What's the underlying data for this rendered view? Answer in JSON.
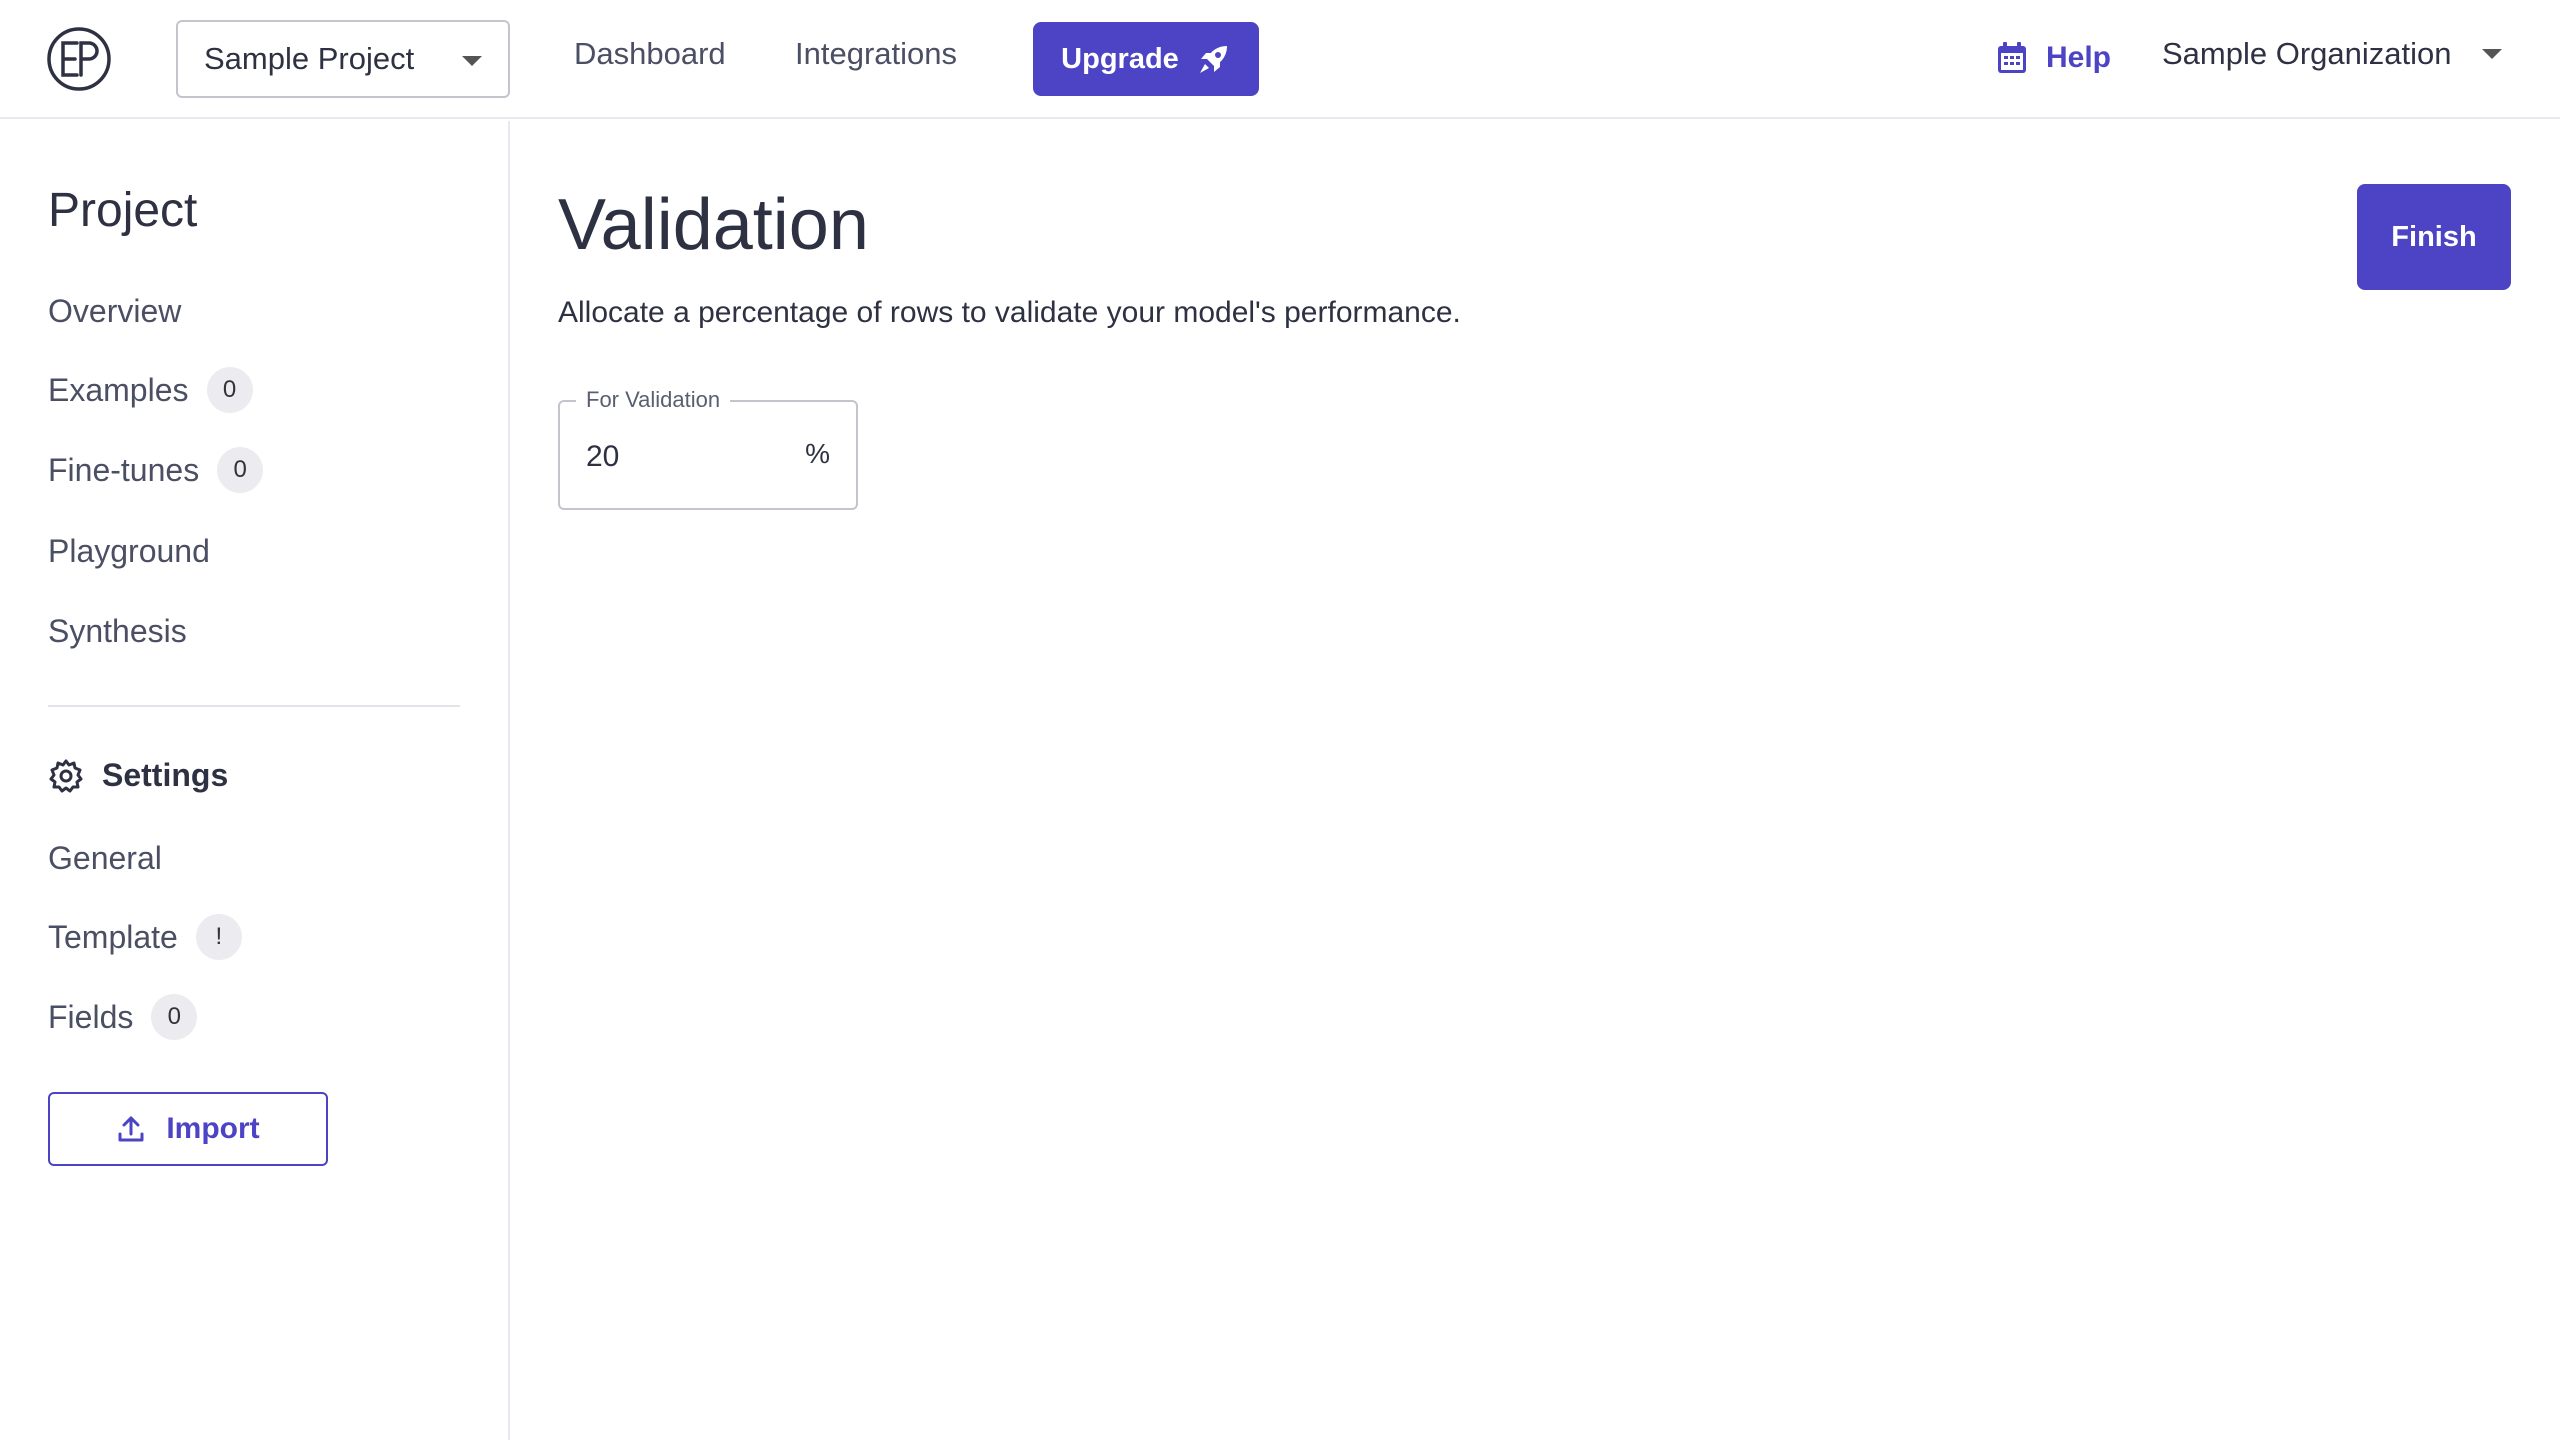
{
  "header": {
    "project_selector": "Sample Project",
    "nav": [
      "Dashboard",
      "Integrations"
    ],
    "upgrade_label": "Upgrade",
    "help_label": "Help",
    "organization": "Sample Organization"
  },
  "sidebar": {
    "title": "Project",
    "project_items": [
      {
        "label": "Overview",
        "badge": null
      },
      {
        "label": "Examples",
        "badge": "0"
      },
      {
        "label": "Fine-tunes",
        "badge": "0"
      },
      {
        "label": "Playground",
        "badge": null
      },
      {
        "label": "Synthesis",
        "badge": null
      }
    ],
    "settings_label": "Settings",
    "settings_items": [
      {
        "label": "General",
        "badge": null
      },
      {
        "label": "Template",
        "badge": "!"
      },
      {
        "label": "Fields",
        "badge": "0"
      }
    ],
    "import_label": "Import"
  },
  "main": {
    "title": "Validation",
    "description": "Allocate a percentage of rows to validate your model's performance.",
    "finish_label": "Finish",
    "validation_field": {
      "label": "For Validation",
      "value": "20",
      "suffix": "%"
    }
  },
  "colors": {
    "accent": "#4c44c4",
    "text": "#2d3142",
    "border": "#c4c4cc"
  },
  "icons": {
    "logo": "ep-logo-icon",
    "upgrade": "rocket-icon",
    "help": "calendar-icon",
    "settings": "gear-icon",
    "import": "upload-icon"
  }
}
